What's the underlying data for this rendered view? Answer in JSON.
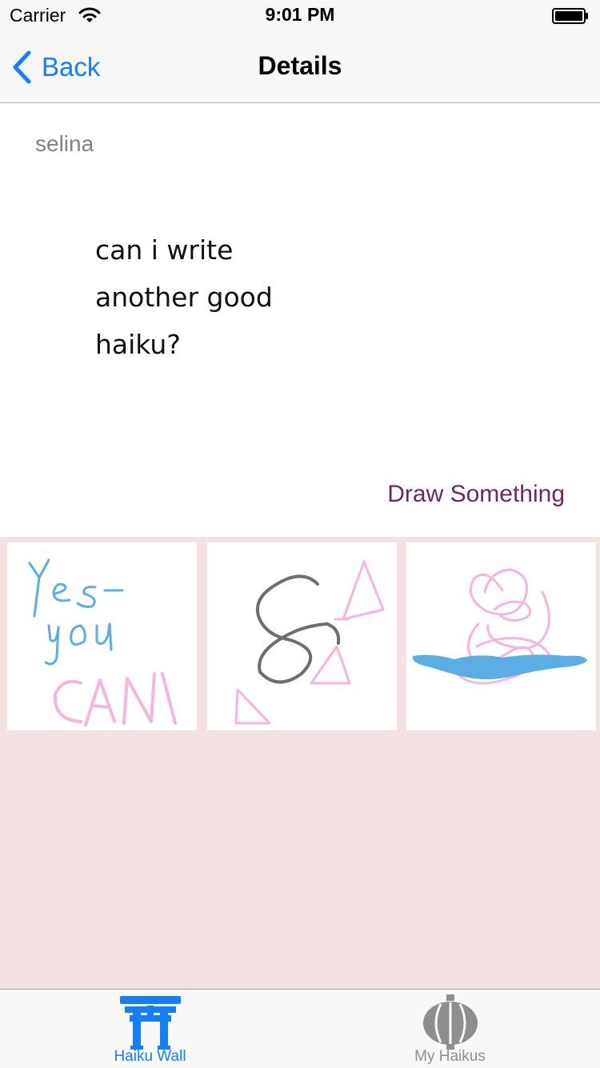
{
  "status_bar": {
    "carrier": "Carrier",
    "time": "9:01 PM"
  },
  "nav": {
    "back_label": "Back",
    "title": "Details"
  },
  "post": {
    "author": "selina",
    "haiku_lines": [
      "can i write",
      "another good",
      "haiku?"
    ]
  },
  "draw_button": {
    "label": "Draw Something",
    "color": "#6b2a5f"
  },
  "drawings": {
    "background": "#f4e2e2",
    "items": [
      {
        "name": "drawing-yes-you-can",
        "caption": "Yes you CAN"
      },
      {
        "name": "drawing-8-triangles"
      },
      {
        "name": "drawing-scribble-water"
      }
    ]
  },
  "tab_bar": {
    "tabs": [
      {
        "label": "Haiku Wall",
        "icon": "torii-gate-icon",
        "selected": true,
        "color": "#147efb"
      },
      {
        "label": "My Haikus",
        "icon": "paper-lantern-icon",
        "selected": false,
        "color": "#8e8e8e"
      }
    ]
  },
  "colors": {
    "accent": "#147efb",
    "pen_pink": "#f5b6de",
    "pen_blue": "#5aaee4",
    "pen_gray": "#6e6e6e"
  }
}
